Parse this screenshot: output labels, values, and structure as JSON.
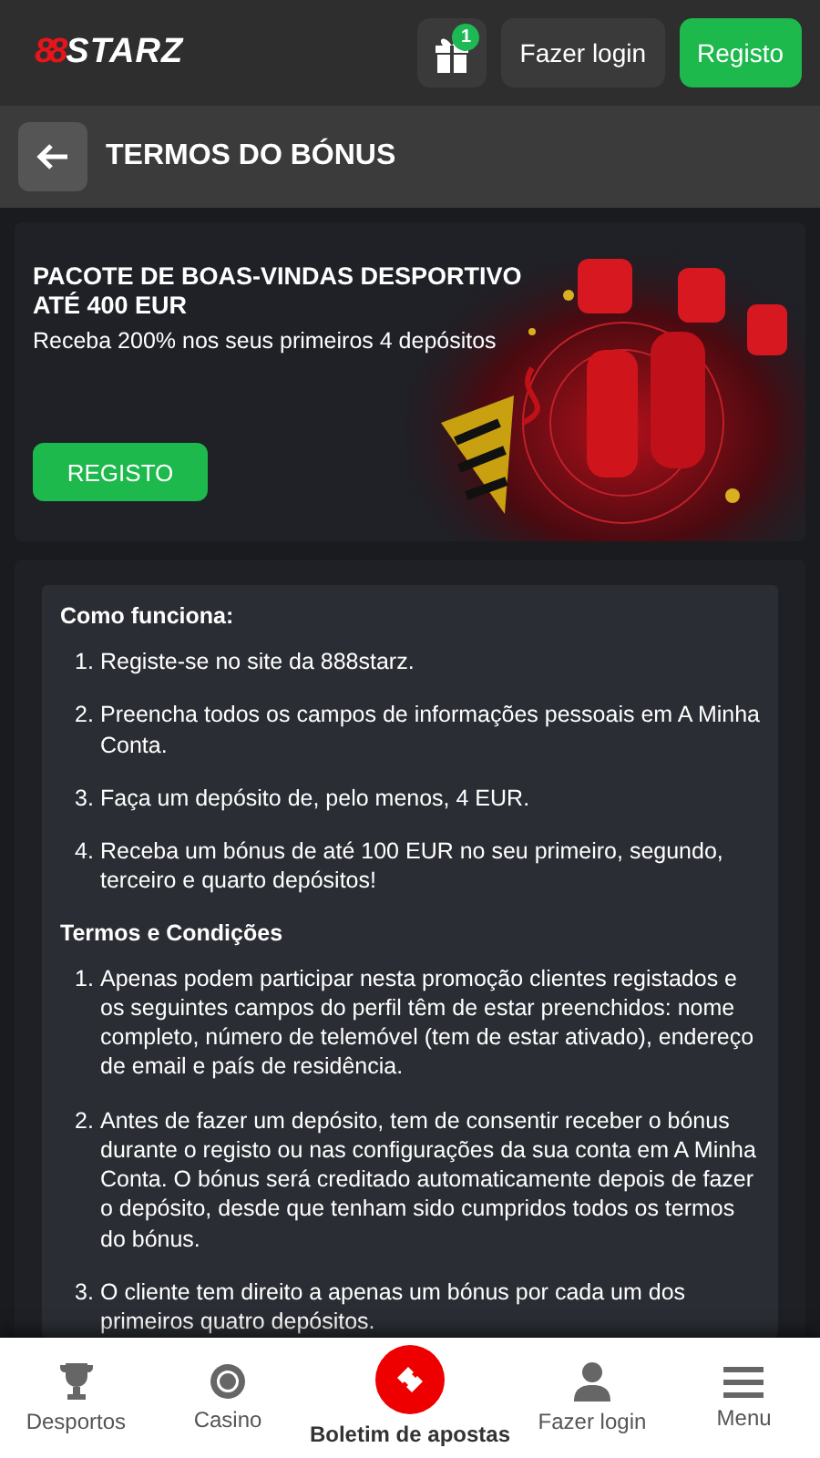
{
  "header": {
    "logo": {
      "mark": "88",
      "name": "STARZ"
    },
    "gift_badge": "1",
    "login": "Fazer login",
    "register": "Registo"
  },
  "page_title": "TERMOS DO BÓNUS",
  "banner": {
    "title": "PACOTE DE BOAS-VINDAS DESPORTIVO ATÉ 400 EUR",
    "subtitle": "Receba 200% nos seus primeiros 4 depósitos",
    "button": "REGISTO",
    "kind": "picture"
  },
  "sections": [
    {
      "heading": "Como funciona:",
      "items": [
        {
          "number": "1.",
          "text": "Registe-se no site da 888starz."
        },
        {
          "number": "2.",
          "text": "Preencha todos os campos de informações pessoais em A Minha Conta."
        },
        {
          "number": "3.",
          "text": "Faça um depósito de, pelo menos, 4 EUR."
        },
        {
          "number": "4.",
          "text": "Receba um bónus de até 100 EUR no seu primeiro, segundo, terceiro e quarto depósitos!"
        }
      ]
    },
    {
      "heading": "Termos e Condições",
      "items": [
        {
          "number": "1.",
          "text": "Apenas podem participar nesta promoção clientes registados e os seguintes campos do perfil têm de estar preenchidos: nome completo, número de telemóvel (tem de estar ativado), endereço de email e país de residência."
        },
        {
          "number": "2.",
          "text": "Antes de fazer um depósito, tem de consentir receber o bónus durante o registo ou nas configurações da sua conta em A Minha Conta. O bónus será creditado automaticamente depois de fazer o depósito, desde que tenham sido cumpridos todos os termos do bónus."
        },
        {
          "number": "3.",
          "text": "O cliente tem direito a apenas um bónus por cada um dos primeiros quatro depósitos."
        }
      ]
    }
  ],
  "bottom_nav": [
    {
      "label": "Desportos",
      "kind": "trophy",
      "selected": false
    },
    {
      "label": "Casino",
      "kind": "chip",
      "selected": false
    },
    {
      "label": "Boletim de apostas",
      "kind": "ticket",
      "selected": true
    },
    {
      "label": "Fazer login",
      "kind": "person",
      "selected": false
    },
    {
      "label": "Menu",
      "kind": "menu",
      "selected": false
    }
  ]
}
